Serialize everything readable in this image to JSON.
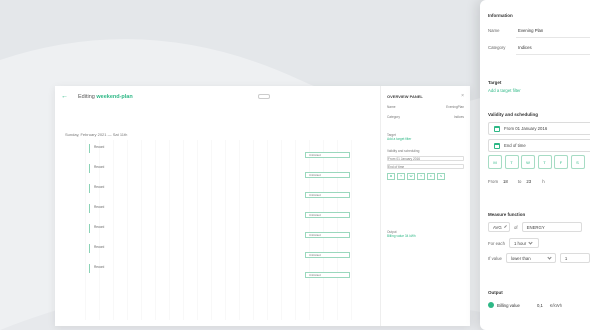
{
  "background_window": {
    "back_arrow": "←",
    "title_prefix": "Editing",
    "title_name": "weekend-plan",
    "date_header": "Sunday, February 2021 — Sat 11th",
    "row_label": "Record",
    "block_label": "Unlimited",
    "side_title": "OVERVIEW PANEL",
    "side_close": "×",
    "side_name_label": "Name",
    "side_name_value": "EveningPlan",
    "side_category_label": "Category",
    "side_category_value": "Indices",
    "side_target_label": "Target",
    "side_target_link": "Add a target filter",
    "side_validity": "Validity and scheduling",
    "side_from": "From 01 January 2016",
    "side_to": "End of time",
    "side_output": "Output",
    "side_output_value": "Billing value 34 kWh"
  },
  "panel": {
    "information_heading": "Information",
    "name_label": "Name",
    "name_value": "Evening Plan",
    "category_label": "Category",
    "category_value": "Indices",
    "target_label": "Target",
    "target_link": "Add a target filter",
    "validity_heading": "Validity and scheduling",
    "from_text": "From 01 January 2016",
    "to_text": "End of time",
    "days": [
      "M",
      "T",
      "W",
      "T",
      "F",
      "S"
    ],
    "from_time_label": "From",
    "from_time_value": "18",
    "to_time_label": "to",
    "to_time_value": "23",
    "hour_unit": "h",
    "measure_heading": "Measure function",
    "agg_value": "AVG",
    "of_text": "of",
    "measure_value": "ENERGY",
    "for_each_label": "For each",
    "for_each_value": "1 hour",
    "if_value_label": "If value",
    "compare_value": "lower than",
    "threshold_value": "1",
    "output_heading": "Output",
    "output_radio_label": "Billing value",
    "output_rate": "0,1",
    "output_unit": "€/kWh"
  }
}
